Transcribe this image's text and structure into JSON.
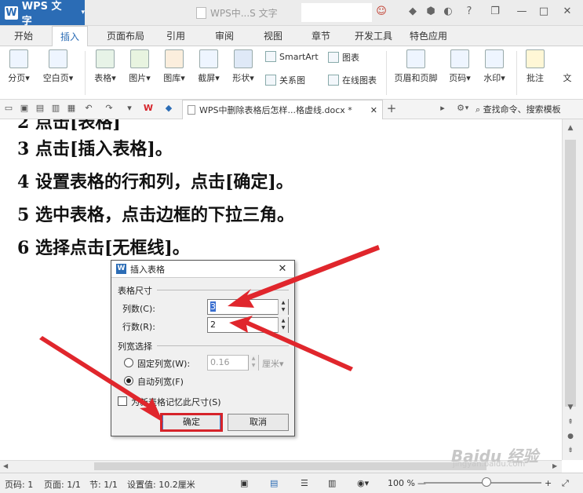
{
  "app": {
    "name": "WPS 文字",
    "caret": "▾",
    "doc_title": "WPS中...S 文字"
  },
  "window_controls": {
    "minimize": "—",
    "restore": "❐",
    "close": "✕",
    "help": "?"
  },
  "tabs": [
    "开始",
    "插入",
    "页面布局",
    "引用",
    "审阅",
    "视图",
    "章节",
    "开发工具",
    "特色应用"
  ],
  "active_tab": "插入",
  "ribbon": {
    "big": [
      {
        "label": "分页",
        "caret": "▾"
      },
      {
        "label": "空白页",
        "caret": "▾"
      },
      {
        "label": "表格",
        "caret": "▾"
      },
      {
        "label": "图片",
        "caret": "▾"
      },
      {
        "label": "图库",
        "caret": "▾"
      },
      {
        "label": "截屏",
        "caret": "▾"
      },
      {
        "label": "形状",
        "caret": "▾"
      },
      {
        "label": "页眉和页脚",
        "caret": ""
      },
      {
        "label": "页码",
        "caret": "▾"
      },
      {
        "label": "水印",
        "caret": "▾"
      },
      {
        "label": "批注",
        "caret": ""
      },
      {
        "label": "文",
        "caret": ""
      }
    ],
    "small": [
      "SmartArt",
      "图表",
      "关系图",
      "在线图表"
    ]
  },
  "quickbar": {
    "doc_tab": "WPS中删除表格后怎样...格虚线.docx *",
    "add_tab": "+",
    "search": "查找命令、搜索模板"
  },
  "document": {
    "lines": [
      "2 点击[表格]",
      "3 点击[插入表格]。",
      "4 设置表格的行和列，点击[确定]。",
      "5 选中表格，点击边框的下拉三角。",
      "6 选择点击[无框线]。"
    ]
  },
  "dialog": {
    "title": "插入表格",
    "size_group": "表格尺寸",
    "cols_label": "列数(C):",
    "cols_value": "3",
    "rows_label": "行数(R):",
    "rows_value": "2",
    "width_group": "列宽选择",
    "fixed_label": "固定列宽(W):",
    "fixed_value": "0.16",
    "fixed_unit": "厘米▾",
    "auto_label": "自动列宽(F)",
    "remember_label": "为新表格记忆此尺寸(S)",
    "ok": "确定",
    "cancel": "取消"
  },
  "status": {
    "page_no": "页码: 1",
    "pages": "页面: 1/1",
    "section": "节: 1/1",
    "setting": "设置值: 10.2厘米",
    "zoom": "100 %",
    "zoom_minus": "—",
    "zoom_plus": "+"
  },
  "watermark": {
    "brand": "Baidu 经验",
    "url": "jingyan.baidu.com"
  },
  "colors": {
    "accent": "#2b6cb5",
    "highlight": "#d6232a"
  }
}
